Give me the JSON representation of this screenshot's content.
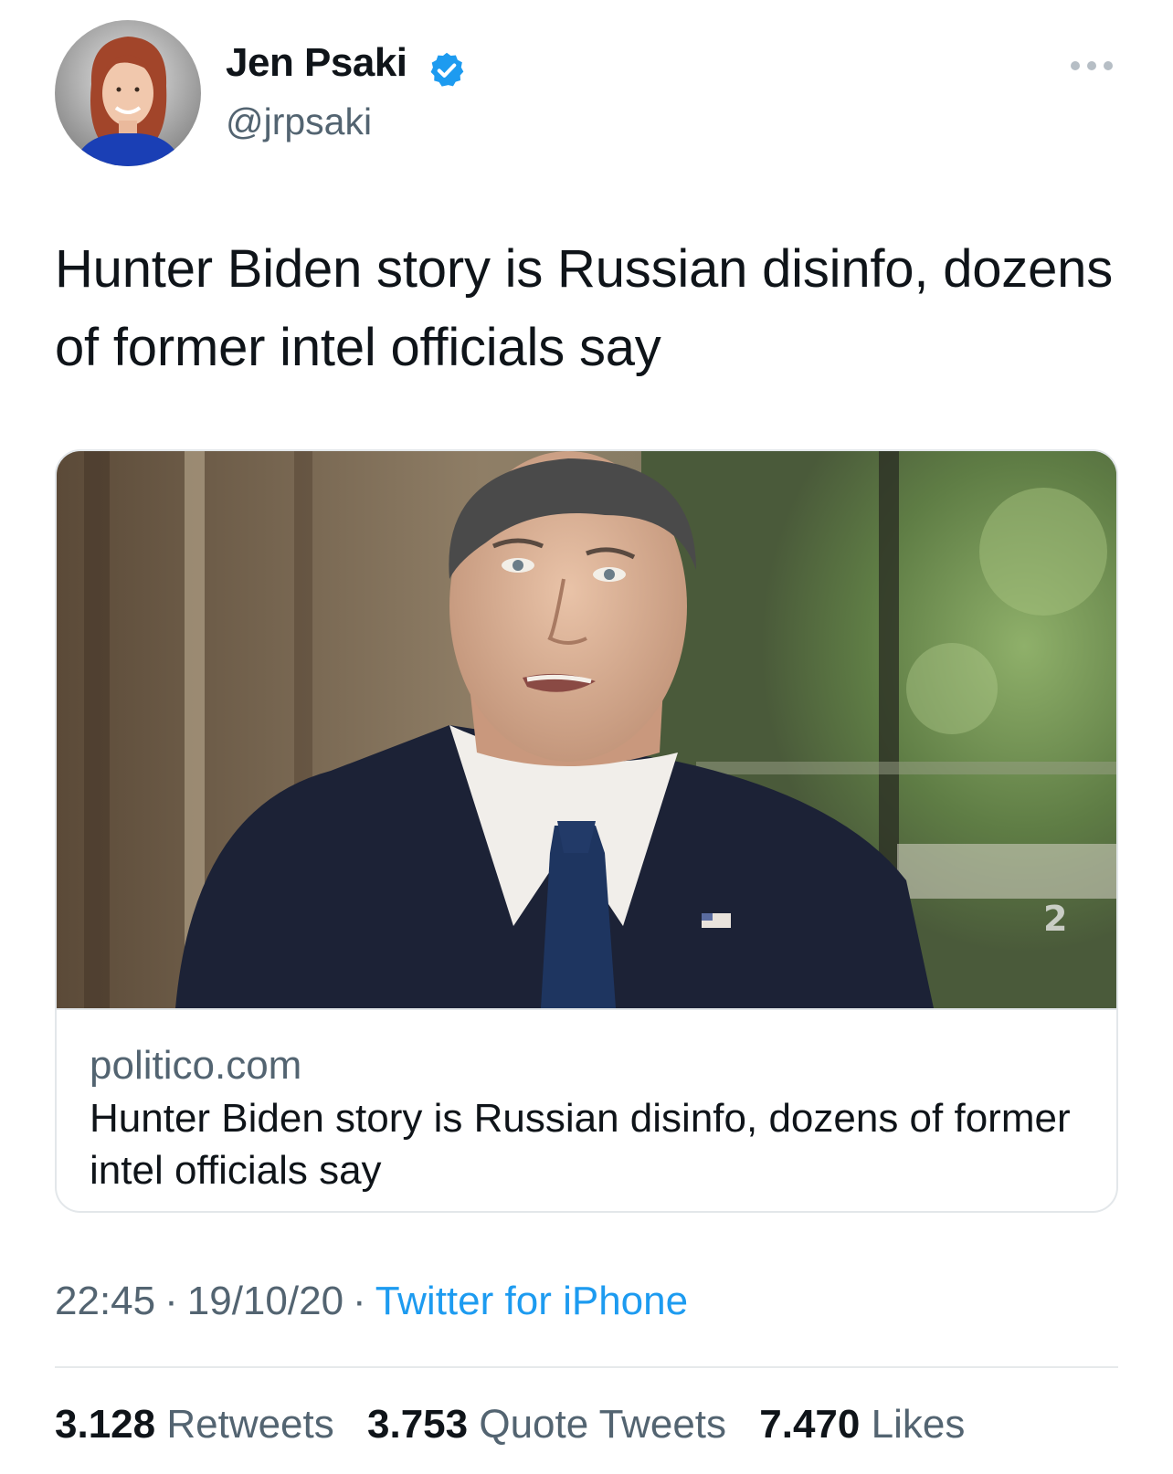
{
  "author": {
    "name": "Jen Psaki",
    "handle": "@jrpsaki",
    "verified": true
  },
  "tweet": {
    "text": "Hunter Biden story is Russian disinfo, dozens of former intel officials say"
  },
  "card": {
    "domain": "politico.com",
    "title": "Hunter Biden story is Russian disinfo, dozens of former intel officials say"
  },
  "meta": {
    "time": "22:45",
    "date": "19/10/20",
    "separator": "·",
    "source": "Twitter for iPhone"
  },
  "stats": {
    "retweets_count": "3.128",
    "retweets_label": "Retweets",
    "quotes_count": "3.753",
    "quotes_label": "Quote Tweets",
    "likes_count": "7.470",
    "likes_label": "Likes"
  },
  "colors": {
    "accent": "#1d9bf0",
    "secondary_text": "#536471",
    "primary_text": "#0f1419"
  },
  "icons": {
    "verified": "verified-badge-icon",
    "more": "more-horizontal-icon"
  }
}
